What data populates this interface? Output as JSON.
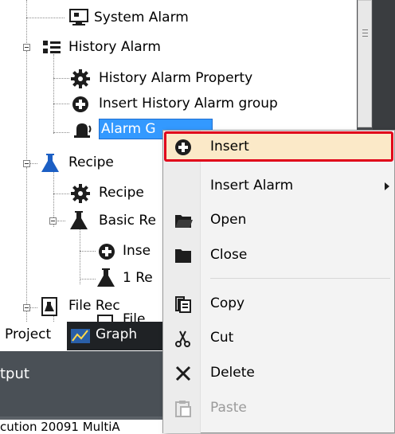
{
  "tree": {
    "items": [
      {
        "label": "System Alarm",
        "icon": "monitor-icon"
      },
      {
        "label": "History Alarm",
        "icon": "list-icon"
      },
      {
        "label": "History Alarm Property",
        "icon": "gear-icon"
      },
      {
        "label": "Insert History Alarm group",
        "icon": "plus-circle-icon"
      },
      {
        "label": "Alarm G",
        "icon": "alarm-bell-icon",
        "selected": true
      },
      {
        "label": "Recipe",
        "icon": "flask-icon"
      },
      {
        "label": "Recipe",
        "icon": "gear-icon"
      },
      {
        "label": "Basic Re",
        "icon": "flask-icon"
      },
      {
        "label": "Inse",
        "icon": "plus-circle-icon"
      },
      {
        "label": "1 Re",
        "icon": "flask-icon"
      },
      {
        "label": "File Rec",
        "icon": "file-recipe-icon"
      },
      {
        "label": "File",
        "icon": "file-recipe-icon"
      }
    ]
  },
  "tabs": {
    "project_label": "Project",
    "graph_label": "Graph"
  },
  "output": {
    "title": "tput",
    "line": "cution 20091 MultiA"
  },
  "context_menu": {
    "items": [
      {
        "label": "Insert",
        "icon": "plus-circle-icon",
        "highlighted": true
      },
      {
        "label": "Insert Alarm",
        "icon": "",
        "submenu": true
      },
      {
        "label": "Open",
        "icon": "folder-open-icon"
      },
      {
        "label": "Close",
        "icon": "folder-closed-icon"
      },
      {
        "label": "Copy",
        "icon": "copy-icon"
      },
      {
        "label": "Cut",
        "icon": "scissors-icon"
      },
      {
        "label": "Delete",
        "icon": "delete-x-icon"
      },
      {
        "label": "Paste",
        "icon": "paste-icon",
        "disabled": true
      }
    ]
  },
  "colors": {
    "selection": "#3399ff",
    "highlight_border": "#e0001a",
    "highlight_fill": "#fbe9c8",
    "recipe_blue": "#1c5fc4"
  }
}
